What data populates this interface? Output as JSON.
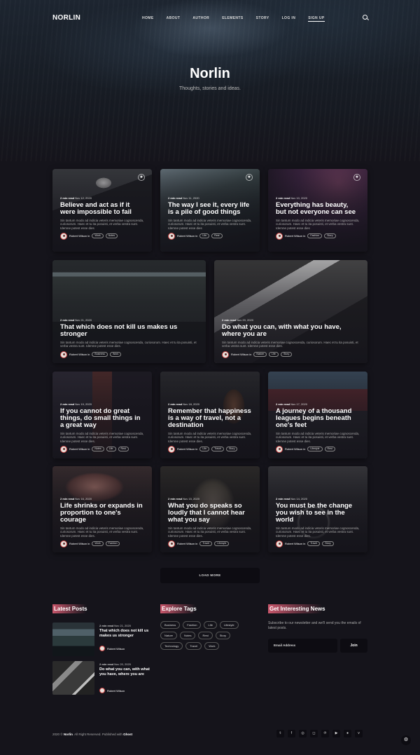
{
  "header": {
    "logo": "NORLIN",
    "menu": [
      "HOME",
      "ABOUT",
      "AUTHOR",
      "ELEMENTS",
      "STORY",
      "LOG IN",
      "SIGN UP"
    ],
    "title": "Norlin",
    "description": "Thoughts, stories and ideas."
  },
  "posts": [
    {
      "read": "2 min read",
      "date": "Nov 12, 2020",
      "title": "Believe and act as if it were impossible to fail",
      "excerpt": "Sin tantum modo ad indicia veteris memoriae cognoscenda, curiosorum. Haec et tu ita posuisti, et verba vestra sunt. Idemne potest esse dies",
      "author": "Robert Wilson in",
      "tags": [
        "Work",
        "Notes"
      ],
      "featured": true
    },
    {
      "read": "2 min read",
      "date": "Nov 11, 2020",
      "title": "The way I see it, every life is a pile of good things",
      "excerpt": "Sin tantum modo ad indicia veteris memoriae cognoscenda, curiosorum. Haec et tu ita posuisti, et verba vestra sunt. Idemne potest esse dies",
      "author": "Robert Wilson in",
      "tags": [
        "Life",
        "Rest"
      ],
      "featured": true
    },
    {
      "read": "2 min read",
      "date": "Nov 10, 2020",
      "title": "Everything has beauty, but not everyone can see",
      "excerpt": "Sin tantum modo ad indicia veteris memoriae cognoscenda, curiosorum. Haec et tu ita posuisti, et verba vestra sunt. Idemne potest esse dies",
      "author": "Robert Wilson in",
      "tags": [
        "Fashion",
        "Story"
      ],
      "featured": true
    },
    {
      "read": "2 min read",
      "date": "Nov 21, 2020",
      "title": "That which does not kill us makes us stronger",
      "excerpt": "Sin tantum modo ad indicia veteris memoriae cognoscenda, curiosorum. Haec et tu ita posuisti, et verba vestra sunt. Idemne potest esse dies.",
      "author": "Robert Wilson in",
      "tags": [
        "Business",
        "Work"
      ]
    },
    {
      "read": "2 min read",
      "date": "Nov 20, 2020",
      "title": "Do what you can, with what you have, where you are",
      "excerpt": "Sin tantum modo ad indicia veteris memoriae cognoscenda, curiosorum. Haec et tu ita posuisti, et verba vestra sunt. Idemne potest esse dies.",
      "author": "Robert Wilson in",
      "tags": [
        "Nature",
        "Life",
        "Story"
      ]
    },
    {
      "read": "2 min read",
      "date": "Nov 19, 2020",
      "title": "If you cannot do great things, do small things in a great way",
      "excerpt": "Sin tantum modo ad indicia veteris memoriae cognoscenda, curiosorum. Haec et tu ita posuisti, et verba vestra sunt. Idemne potest esse dies.",
      "author": "Robert Wilson in",
      "tags": [
        "Notes",
        "Life",
        "Rest"
      ]
    },
    {
      "read": "2 min read",
      "date": "Nov 18, 2020",
      "title": "Remember that happiness is a way of travel, not a destination",
      "excerpt": "Sin tantum modo ad indicia veteris memoriae cognoscenda, curiosorum. Haec et tu ita posuisti, et verba vestra sunt. Idemne potest esse dies.",
      "author": "Robert Wilson in",
      "tags": [
        "Life",
        "Travel",
        "Story"
      ]
    },
    {
      "read": "2 min read",
      "date": "Nov 17, 2020",
      "title": "A journey of a thousand leagues begins beneath one's feet",
      "excerpt": "Sin tantum modo ad indicia veteris memoriae cognoscenda, curiosorum. Haec et tu ita posuisti, et verba vestra sunt. Idemne potest esse dies.",
      "author": "Robert Wilson in",
      "tags": [
        "Lifestyle",
        "Rest"
      ]
    },
    {
      "read": "2 min read",
      "date": "Nov 16, 2020",
      "title": "Life shrinks or expands in proportion to one's courage",
      "excerpt": "Sin tantum modo ad indicia veteris memoriae cognoscenda, curiosorum. Haec et tu ita posuisti, et verba vestra sunt. Idemne potest esse dies.",
      "author": "Robert Wilson in",
      "tags": [
        "Work",
        "Fashion"
      ]
    },
    {
      "read": "2 min read",
      "date": "Nov 15, 2020",
      "title": "What you do speaks so loudly that I cannot hear what you say",
      "excerpt": "Sin tantum modo ad indicia veteris memoriae cognoscenda, curiosorum. Haec et tu ita posuisti, et verba vestra sunt. Idemne potest esse dies.",
      "author": "Robert Wilson in",
      "tags": [
        "Travel",
        "Lifestyle"
      ]
    },
    {
      "read": "2 min read",
      "date": "Nov 14, 2020",
      "title": "You must be the change you wish to see in the world",
      "excerpt": "Sin tantum modo ad indicia veteris memoriae cognoscenda, curiosorum. Haec et tu ita posuisti, et verba vestra sunt. Idemne potest esse dies.",
      "author": "Robert Wilson in",
      "tags": [
        "Travel",
        "Story"
      ]
    }
  ],
  "load_more": "LOAD MORE",
  "footer": {
    "latest_title": "Latest Posts",
    "latest": [
      {
        "read": "2 min read",
        "date": "Nov 21, 2020",
        "title": "That which does not kill us makes us stronger",
        "author": "Robert Wilson"
      },
      {
        "read": "2 min read",
        "date": "Nov 20, 2020",
        "title": "Do what you can, with what you have, where you are",
        "author": "Robert Wilson"
      }
    ],
    "tags_title": "Explore Tags",
    "tags": [
      "Business",
      "Fashion",
      "Life",
      "Lifestyle",
      "Nature",
      "Notes",
      "Rest",
      "Story",
      "Technology",
      "Travel",
      "Work"
    ],
    "news_title": "Get Interesting News",
    "news_desc": "Subscribe to our newsletter and we'll send you the emails of latest posts.",
    "email_placeholder": "Email Address",
    "join": "Join",
    "copyright_year": "2020 ©",
    "copyright_brand": "Norlin",
    "copyright_rest": ". All Right Reserved. Published with",
    "copyright_ghost": "Ghost",
    "social": [
      "twitter-icon",
      "facebook-icon",
      "dribbble-icon",
      "instagram-icon",
      "pinterest-icon",
      "youtube-icon",
      "github-icon",
      "vimeo-icon"
    ]
  },
  "colors": {
    "background": "#15141b",
    "accent": "#c9576c",
    "card": "#22212b"
  }
}
